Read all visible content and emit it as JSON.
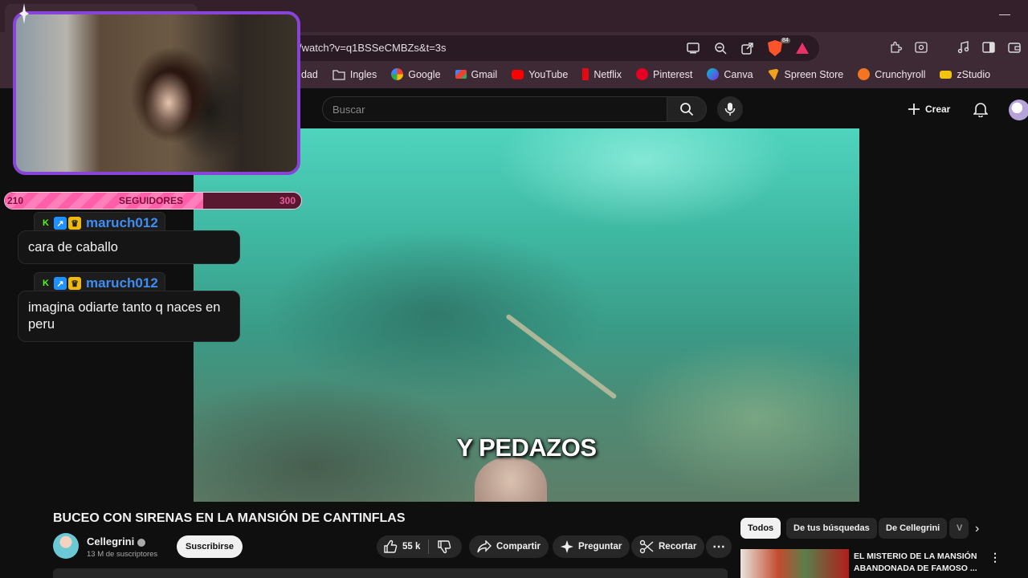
{
  "browser": {
    "url": "/watch?v=q1BSSeCMBZs&t=3s",
    "brave_badge": "84",
    "bookmarks": [
      {
        "label": "dad",
        "icon": "none",
        "color": ""
      },
      {
        "label": "Ingles",
        "icon": "folder-icon",
        "color": "#cccccc"
      },
      {
        "label": "Google",
        "icon": "google-icon",
        "color": "#4285f4"
      },
      {
        "label": "Gmail",
        "icon": "gmail-icon",
        "color": "#ea4335"
      },
      {
        "label": "YouTube",
        "icon": "youtube-icon",
        "color": "#ff0000"
      },
      {
        "label": "Netflix",
        "icon": "netflix-icon",
        "color": "#e50914"
      },
      {
        "label": "Pinterest",
        "icon": "pinterest-icon",
        "color": "#e60023"
      },
      {
        "label": "Canva",
        "icon": "canva-icon",
        "color": "#00c4cc"
      },
      {
        "label": "Spreen Store",
        "icon": "spreen-icon",
        "color": "#f0a21a"
      },
      {
        "label": "Crunchyroll",
        "icon": "crunchyroll-icon",
        "color": "#f47521"
      },
      {
        "label": "zStudio",
        "icon": "zstudio-icon",
        "color": "#f1c40f"
      }
    ]
  },
  "youtube": {
    "search_placeholder": "Buscar",
    "create_label": "Crear",
    "video_caption": "Y PEDAZOS",
    "video_title": "BUCEO CON SIRENAS EN LA MANSIÓN DE CANTINFLAS",
    "channel_name": "Cellegrini",
    "channel_subs": "13 M de suscriptores",
    "subscribe_label": "Suscribirse",
    "likes": "55 k",
    "share_label": "Compartir",
    "ask_label": "Preguntar",
    "clip_label": "Recortar",
    "chips": [
      "Todos",
      "De tus búsquedas",
      "De Cellegrini",
      "V"
    ],
    "rec_title": "EL MISTERIO DE LA MANSIÓN ABANDONADA DE FAMOSO ..."
  },
  "overlay": {
    "goal_start": "210",
    "goal_label": "SEGUIDORES",
    "goal_end": "300",
    "goal_progress": 0.67,
    "chat": [
      {
        "user": "maruch012",
        "message": "cara de caballo"
      },
      {
        "user": "maruch012",
        "message": "imagina odiarte tanto q naces en peru"
      }
    ]
  },
  "colors": {
    "accent_purple": "#8a43d9",
    "goal_pink": "#ff5fa8",
    "chat_username": "#3e8df2"
  }
}
